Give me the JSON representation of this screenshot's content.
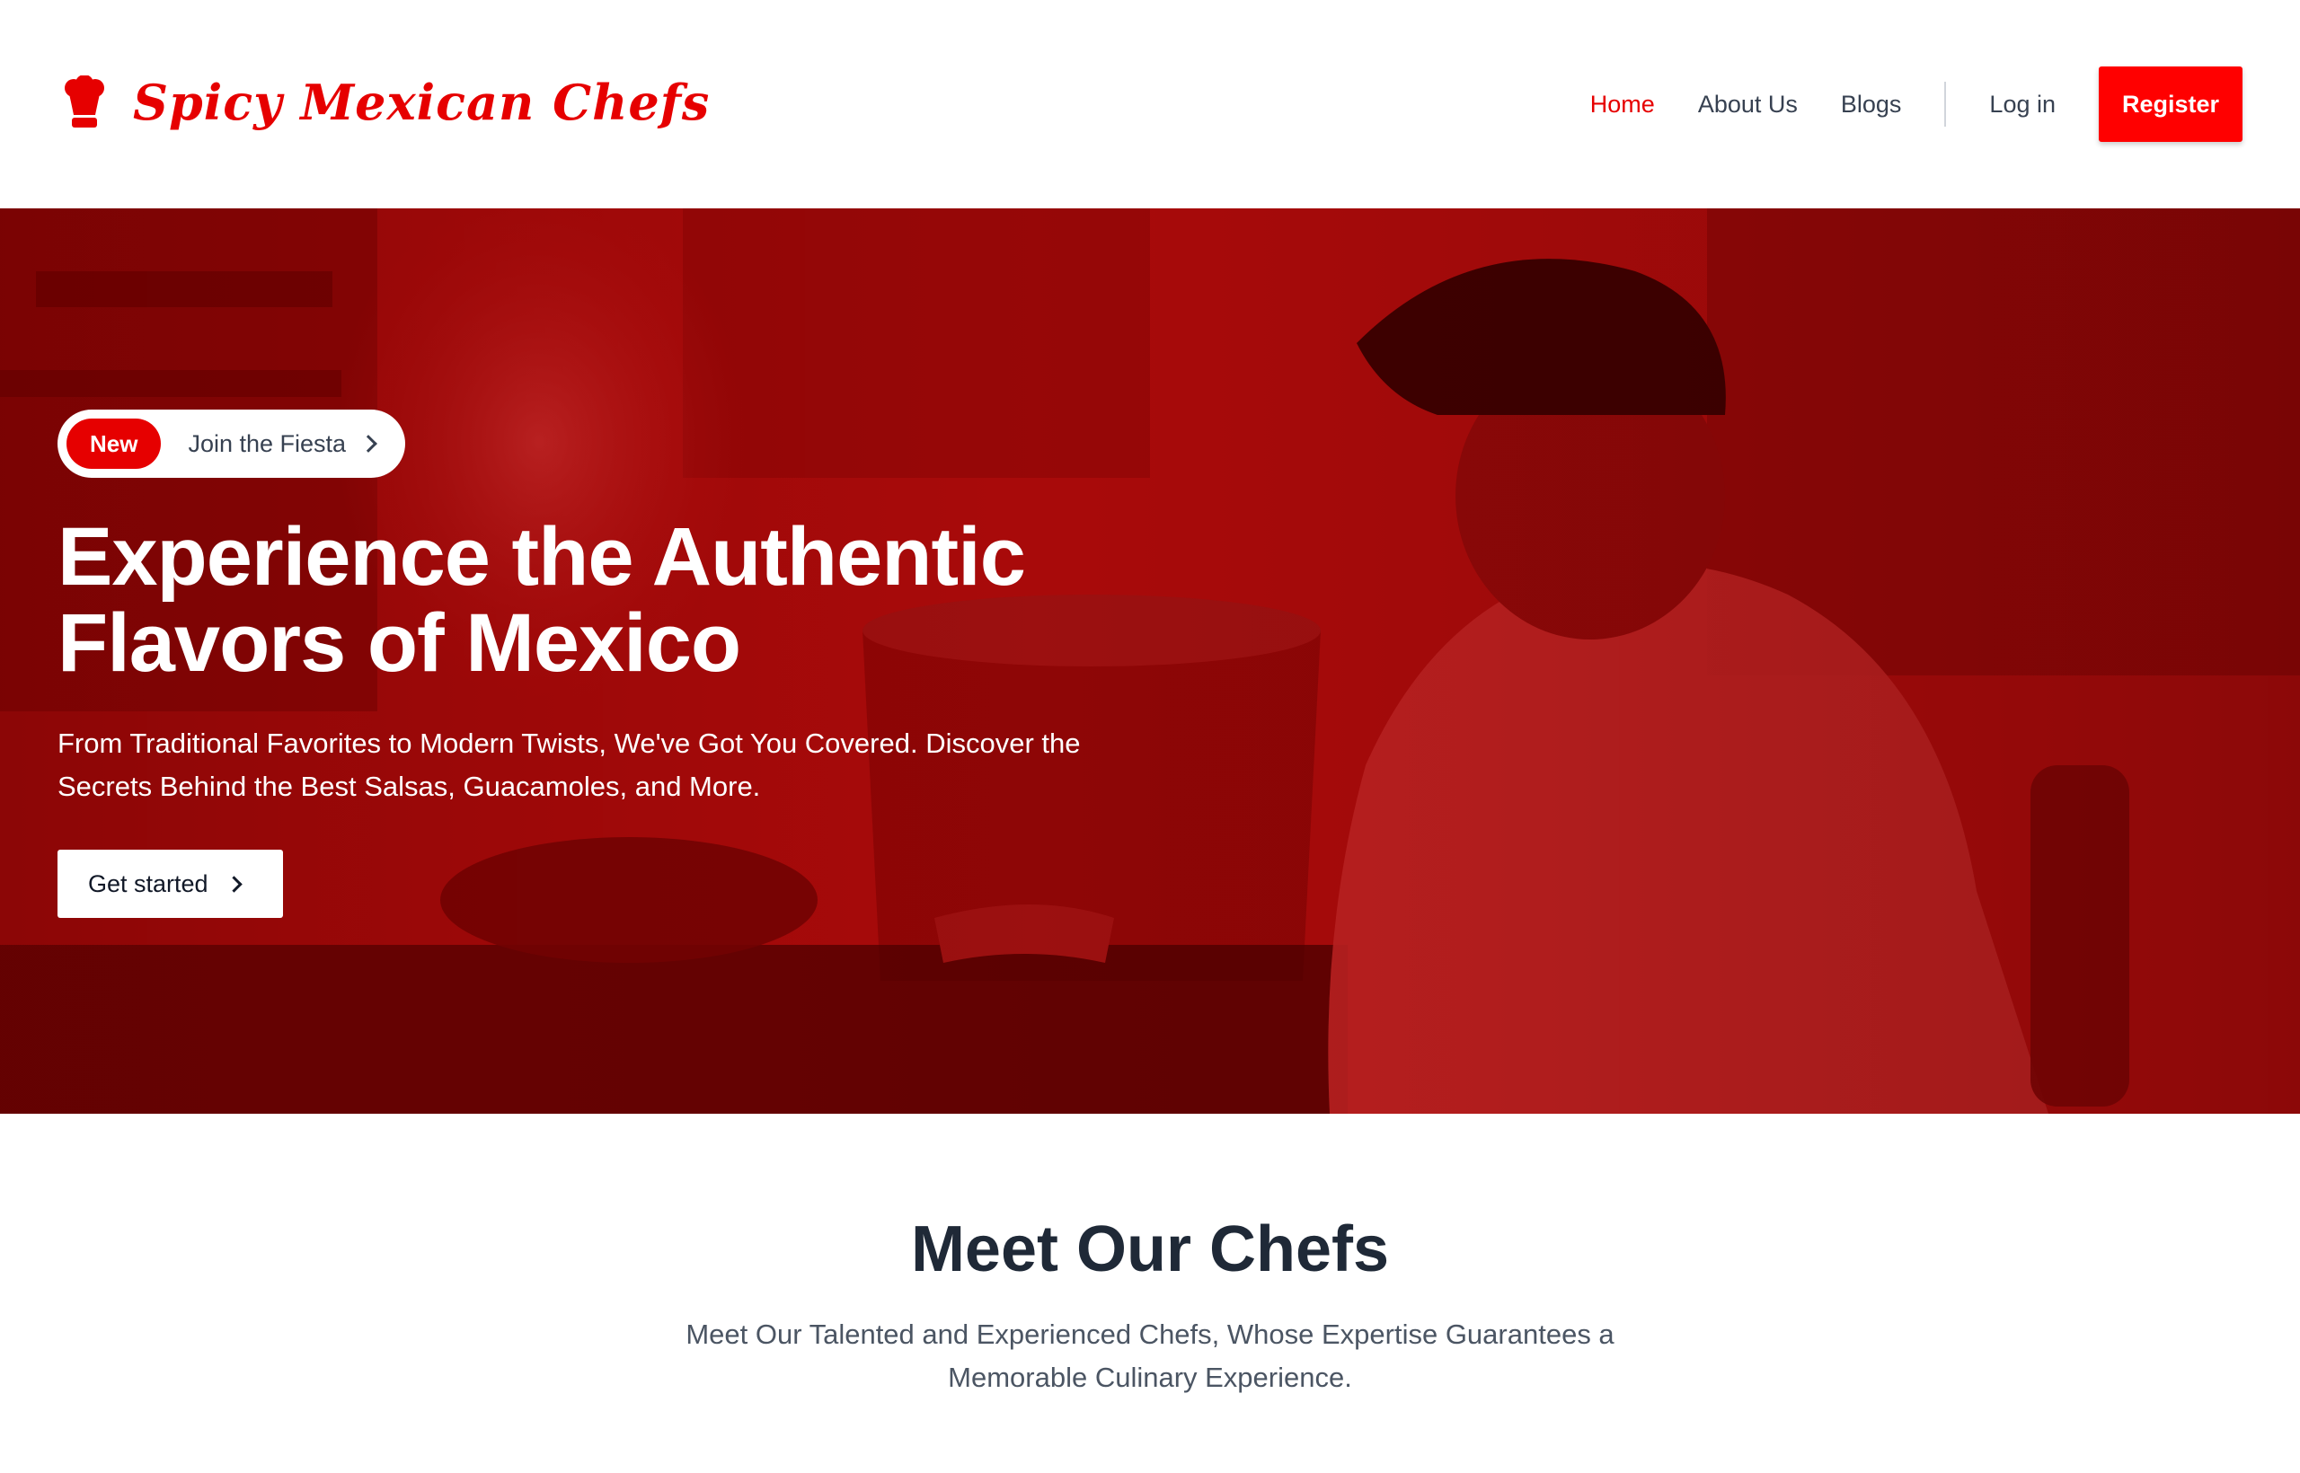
{
  "brand": {
    "name": "Spicy Mexican Chefs",
    "icon": "chef-hat-icon",
    "color": "#e60000"
  },
  "nav": {
    "items": [
      {
        "label": "Home",
        "active": true
      },
      {
        "label": "About Us",
        "active": false
      },
      {
        "label": "Blogs",
        "active": false
      }
    ],
    "login_label": "Log in",
    "register_label": "Register"
  },
  "hero": {
    "badge": "New",
    "announcement": "Join the Fiesta",
    "title_line1": "Experience the Authentic",
    "title_line2": "Flavors of Mexico",
    "subtitle_line1": "From Traditional Favorites to Modern Twists, We've Got You Covered. Discover the",
    "subtitle_line2": "Secrets Behind the Best Salsas, Guacamoles, and More.",
    "cta_label": "Get started",
    "overlay_color": "#c00000"
  },
  "chefs_section": {
    "title": "Meet Our Chefs",
    "subtitle_line1": "Meet Our Talented and Experienced Chefs, Whose Expertise Guarantees a",
    "subtitle_line2": "Memorable Culinary Experience."
  }
}
